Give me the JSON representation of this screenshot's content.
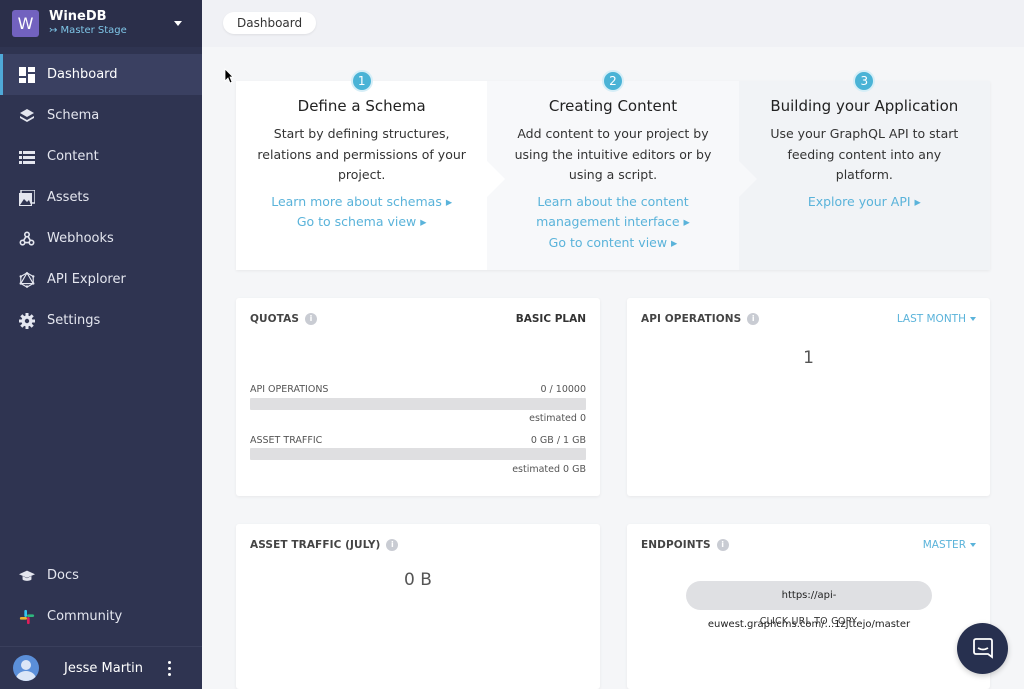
{
  "project": {
    "logo_letter": "W",
    "name": "WineDB",
    "stage": "↣ Master Stage"
  },
  "sidebar": {
    "items": [
      {
        "label": "Dashboard",
        "icon": "dashboard-icon",
        "active": true
      },
      {
        "label": "Schema",
        "icon": "layers-icon"
      },
      {
        "label": "Content",
        "icon": "list-icon"
      },
      {
        "label": "Assets",
        "icon": "image-icon"
      },
      {
        "label": "Webhooks",
        "icon": "webhook-icon"
      },
      {
        "label": "API Explorer",
        "icon": "graphql-icon"
      },
      {
        "label": "Settings",
        "icon": "gear-icon"
      }
    ],
    "bottom_items": [
      {
        "label": "Docs",
        "icon": "graduation-cap-icon"
      },
      {
        "label": "Community",
        "icon": "slack-icon"
      }
    ],
    "user": {
      "name": "Jesse Martin"
    }
  },
  "breadcrumb": {
    "label": "Dashboard"
  },
  "steps": [
    {
      "num": "1",
      "title": "Define a Schema",
      "desc": "Start by defining structures, relations and permissions of your project.",
      "links": [
        "Learn more about schemas ▸",
        "Go to schema view ▸"
      ]
    },
    {
      "num": "2",
      "title": "Creating Content",
      "desc": "Add content to your project by using the intuitive editors or by using a script.",
      "links": [
        "Learn about the content management interface ▸",
        "Go to content view ▸"
      ]
    },
    {
      "num": "3",
      "title": "Building your Application",
      "desc": "Use your GraphQL API to start feeding content into any platform.",
      "links": [
        "Explore your API ▸"
      ]
    }
  ],
  "quotas": {
    "title": "QUOTAS",
    "plan": "BASIC PLAN",
    "api_label": "API OPERATIONS",
    "api_value": "0 / 10000",
    "api_estimated": "estimated 0",
    "api_fraction": 0,
    "asset_label": "ASSET TRAFFIC",
    "asset_value": "0 GB / 1 GB",
    "asset_estimated": "estimated 0 GB",
    "asset_fraction": 0
  },
  "api_operations": {
    "title": "API OPERATIONS",
    "period": "LAST MONTH",
    "value": "1"
  },
  "asset_traffic": {
    "title": "ASSET TRAFFIC (JULY)",
    "value": "0 B"
  },
  "endpoints": {
    "title": "ENDPOINTS",
    "stage": "MASTER",
    "url": "https://api-euwest.graphcms.com/...1zjttejo/master",
    "copy_hint": "CLICK URL TO COPY"
  },
  "info_glyph": "i",
  "colors": {
    "sidebar": "#2f3451",
    "accent": "#5ab3da",
    "logo": "#7262bf"
  }
}
